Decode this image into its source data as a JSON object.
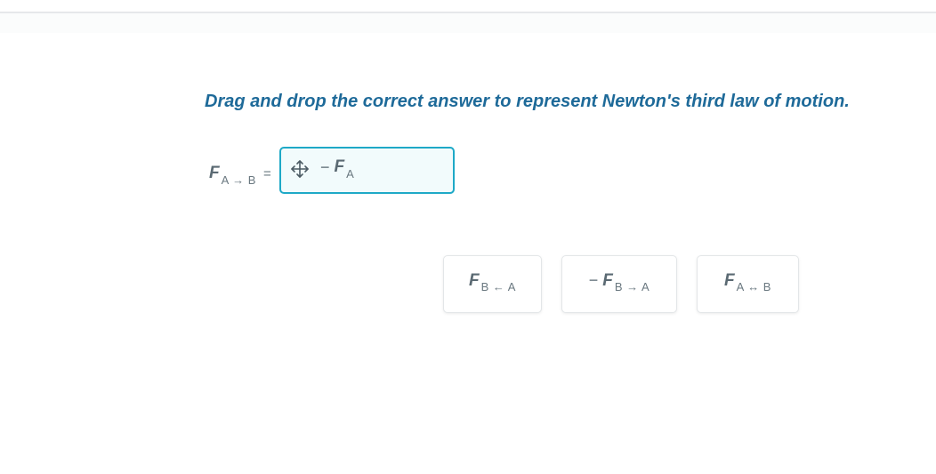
{
  "question": "Drag and drop the correct answer to represent Newton's third law of motion.",
  "equation": {
    "lhs_var": "F",
    "lhs_sub": "A → B",
    "equals": "="
  },
  "drop_zone": {
    "icon": "move-icon",
    "placed_minus": "−",
    "placed_var": "F",
    "placed_sub": "A"
  },
  "options": [
    {
      "minus": "",
      "var": "F",
      "sub": "B ← A"
    },
    {
      "minus": "−",
      "var": "F",
      "sub": "B → A"
    },
    {
      "minus": "",
      "var": "F",
      "sub": "A ↔ B"
    }
  ],
  "colors": {
    "question": "#1e6a99",
    "drop_border": "#1ea9c7",
    "drop_bg": "#f2fbfc",
    "text": "#5b6a73"
  }
}
